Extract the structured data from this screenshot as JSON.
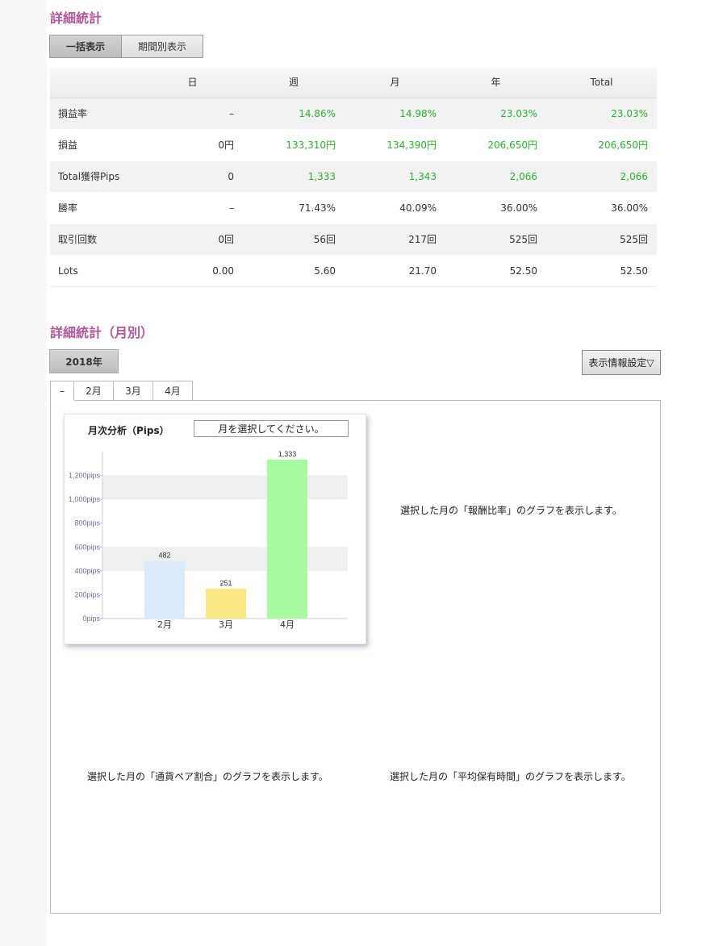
{
  "section1": {
    "title": "詳細統計",
    "tabs": [
      "一括表示",
      "期間別表示"
    ]
  },
  "stats_table": {
    "headers": [
      "",
      "日",
      "週",
      "月",
      "年",
      "Total"
    ],
    "rows": [
      {
        "label": "損益率",
        "values": [
          "–",
          "14.86%",
          "14.98%",
          "23.03%",
          "23.03%"
        ]
      },
      {
        "label": "損益",
        "values": [
          "0円",
          "133,310円",
          "134,390円",
          "206,650円",
          "206,650円"
        ]
      },
      {
        "label": "Total獲得Pips",
        "values": [
          "0",
          "1,333",
          "1,343",
          "2,066",
          "2,066"
        ]
      },
      {
        "label": "勝率",
        "values": [
          "–",
          "71.43%",
          "40.09%",
          "36.00%",
          "36.00%"
        ]
      },
      {
        "label": "取引回数",
        "values": [
          "0回",
          "56回",
          "217回",
          "525回",
          "525回"
        ]
      },
      {
        "label": "Lots",
        "values": [
          "0.00",
          "5.60",
          "21.70",
          "52.50",
          "52.50"
        ]
      }
    ]
  },
  "section2": {
    "title": "詳細統計（月別）",
    "year_label": "2018年",
    "settings_label": "表示情報設定▽",
    "month_tabs": [
      "–",
      "2月",
      "3月",
      "4月"
    ]
  },
  "chart_panel": {
    "title": "月次分析（Pips）",
    "select_placeholder": "月を選択してください。"
  },
  "chart_data": {
    "type": "bar",
    "title": "月次分析（Pips）",
    "categories": [
      "2月",
      "3月",
      "4月"
    ],
    "values": [
      482,
      251,
      1333
    ],
    "data_labels": [
      "482",
      "251",
      "1,333"
    ],
    "bar_colors": [
      "#dcebfb",
      "#fbe884",
      "#a9fba0"
    ],
    "yticks": [
      {
        "value": 0,
        "label": "0pips"
      },
      {
        "value": 200,
        "label": "200pips"
      },
      {
        "value": 400,
        "label": "400pips"
      },
      {
        "value": 600,
        "label": "600pips"
      },
      {
        "value": 800,
        "label": "800pips"
      },
      {
        "value": 1000,
        "label": "1,000pips"
      },
      {
        "value": 1200,
        "label": "1,200pips"
      }
    ],
    "ylim": [
      0,
      1400
    ],
    "xlabel": "",
    "ylabel": ""
  },
  "notes": {
    "ratio": "選択した月の「報酬比率」のグラフを表示します。",
    "pair": "選択した月の「通貨ペア割合」のグラフを表示します。",
    "holding": "選択した月の「平均保有時間」のグラフを表示します。"
  },
  "colors": {
    "section_title": "#b0569a",
    "positive": "#2ab22a"
  }
}
